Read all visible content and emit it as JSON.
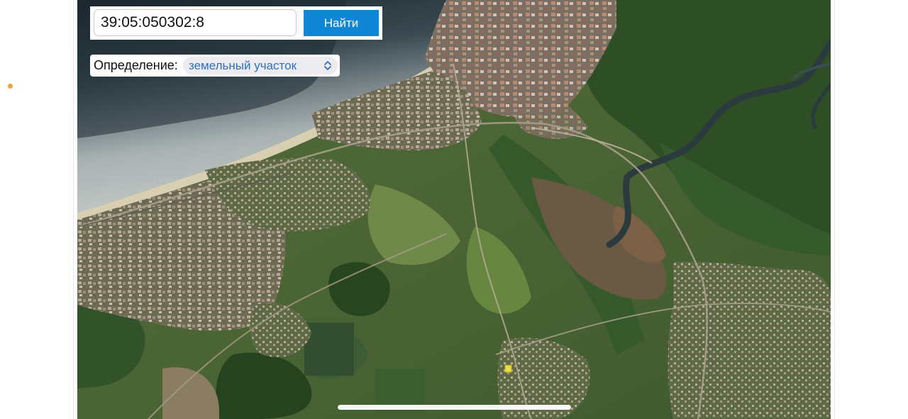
{
  "search": {
    "query": "39:05:050302:8",
    "button_label": "Найти"
  },
  "definition": {
    "label": "Определение:",
    "selected": "земельный участок"
  },
  "map": {
    "style": "satellite",
    "colors": {
      "sea_dark": "#1d2a33",
      "sea_light": "#b9c0c1",
      "beach": "#d9cdb0",
      "forest": "#2f5128",
      "field": "#5f7a3e",
      "marsh": "#6b5a45",
      "river": "#2c3a3e",
      "town": "#8a8070"
    }
  },
  "colors": {
    "accent": "#0f86d6",
    "select_text": "#2f6fbf",
    "marker": "#f2a23a"
  }
}
